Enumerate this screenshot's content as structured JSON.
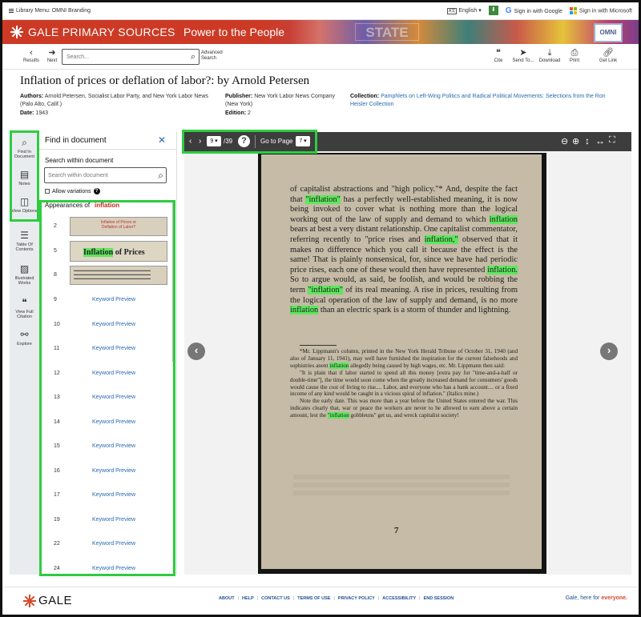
{
  "topbar": {
    "library_menu": "Library Menu: OMNI Branding",
    "language": "English",
    "language_icon": "translate-icon",
    "google_signin": "Sign in with Google",
    "microsoft_signin": "Sign in with Microsoft"
  },
  "banner": {
    "brand": "GALE PRIMARY SOURCES",
    "tagline": "Power to the People",
    "omni": "OMNI"
  },
  "toolbar": {
    "results": "Results",
    "next": "Next",
    "search_placeholder": "Search...",
    "advanced_search": "Advanced Search",
    "cite": "Cite",
    "send_to": "Send To...",
    "download": "Download",
    "print": "Print",
    "get_link": "Get Link"
  },
  "document": {
    "title": "Inflation of prices or deflation of labor?: by Arnold Petersen",
    "authors_label": "Authors:",
    "authors": "Arnold Petersen, Socialist Labor Party, and New York Labor News (Palo Alto, Calif.)",
    "date_label": "Date:",
    "date": "1943",
    "publisher_label": "Publisher:",
    "publisher": "New York Labor News Company (New York)",
    "edition_label": "Edition:",
    "edition": "2",
    "collection_label": "Collection:",
    "collection": "Pamphlets on Left-Wing Politics and Radical Political Movements: Selections from the Ron Heisler Collection"
  },
  "rail": {
    "find": "Find In Document",
    "notes": "Notes",
    "view_options": "View Options",
    "toc": "Table Of Contents",
    "illustrated": "Illustrated Works",
    "citation": "View Full Citation",
    "explore": "Explore"
  },
  "find_panel": {
    "title": "Find in document",
    "search_label": "Search within document",
    "search_placeholder": "Search within document",
    "allow_variations": "Allow variations",
    "appearances_label": "Appearances of",
    "keyword": "inflation",
    "thumb1_text": "Inflation of Prices or Deflation of Labor?",
    "thumb2_word": "Inflation",
    "thumb2_rest": " of Prices",
    "results": [
      {
        "page": "2"
      },
      {
        "page": "5"
      },
      {
        "page": "8"
      },
      {
        "page": "9",
        "label": "Keyword Preview"
      },
      {
        "page": "10",
        "label": "Keyword Preview"
      },
      {
        "page": "11",
        "label": "Keyword Preview"
      },
      {
        "page": "12",
        "label": "Keyword Preview"
      },
      {
        "page": "13",
        "label": "Keyword Preview"
      },
      {
        "page": "14",
        "label": "Keyword Preview"
      },
      {
        "page": "15",
        "label": "Keyword Preview"
      },
      {
        "page": "16",
        "label": "Keyword Preview"
      },
      {
        "page": "17",
        "label": "Keyword Preview"
      },
      {
        "page": "19",
        "label": "Keyword Preview"
      },
      {
        "page": "22",
        "label": "Keyword Preview"
      },
      {
        "page": "24",
        "label": "Keyword Preview"
      }
    ]
  },
  "viewer": {
    "current_page": "9",
    "total_pages": "/39",
    "goto_label": "Go to Page",
    "goto_value": "7",
    "page_number": "7"
  },
  "page_text": {
    "p1": "of capitalist abstractions and \"high policy.\"* And, despite the fact that ",
    "h1": "\"inflation\"",
    "p2": " has a perfectly well-established meaning, it is now being invoked to cover what is nothing more than the logical working out of the law of supply and demand to which ",
    "h2": "inflation",
    "p3": " bears at best a very distant relationship. One capitalist commentator, referring recently to \"price rises and ",
    "h3": "inflation,\"",
    "p4": " observed that it makes no difference which you call it because the effect is the same! That is plainly nonsensical, for, since we have had periodic price rises, each one of these would then have represented ",
    "h4": "inflation.",
    "p5": " So to argue would, as said, be foolish, and would be robbing the term ",
    "h5": "\"inflation\"",
    "p6": " of its real meaning. A rise in prices, resulting from the logical operation of the law of supply and demand, is no more ",
    "h6": "inflation",
    "p7": " than an electric spark is a storm of thunder and lightning.",
    "f1": "*Mr. Lippmann's column, printed in the New York Herald Tribune of October 31, 1940 (and also of January 11, 1941), may well have furnished the inspiration for the current falsehoods and sophistries anent ",
    "fh1": "inflation",
    "f2": " allegedly being caused by high wages, etc. Mr. Lippmann then said:",
    "f3": "\"It is plain that if labor started to spend all this money [extra pay for \"time-and-a-half or double-time\"], the time would soon come when the greatly increased demand for consumers' goods would cause the cost of living to rise.... Labor, and everyone who has a bank account.... or a fixed income of any kind would be caught in a vicious spiral of inflation.\" (Italics mine.)",
    "f4": "Note the early date. This was more than a year before the United States entered the war. This indicates clearly that, war or peace the workers are never to be allowed to earn above a certain amount, lest the ",
    "fh2": "\"inflation",
    "f5": " gobbleuns\" get us, and wreck capitalist society!"
  },
  "footer": {
    "logo": "GALE",
    "links": [
      "ABOUT",
      "HELP",
      "CONTACT US",
      "TERMS OF USE",
      "PRIVACY POLICY",
      "ACCESSIBILITY",
      "END SESSION"
    ],
    "tagline_pre": "Gale, here for ",
    "tagline_em": "everyone."
  },
  "colors": {
    "brand_red": "#cc3a25",
    "highlight": "#5ee65e",
    "annotation": "#2ecc40",
    "link": "#2a6ab0"
  }
}
